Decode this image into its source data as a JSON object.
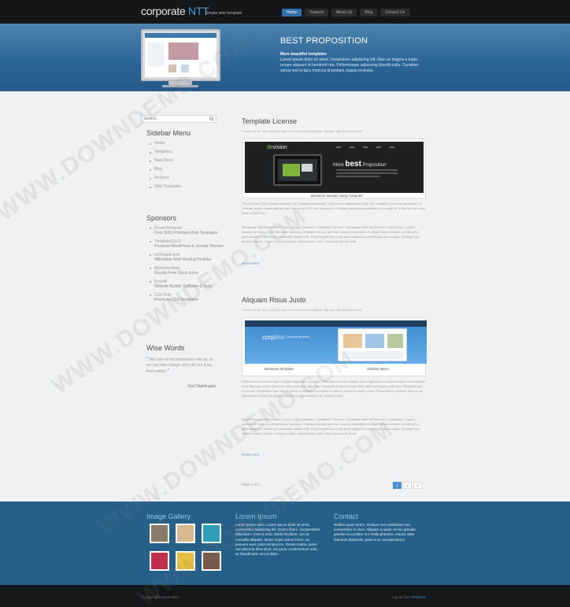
{
  "header": {
    "logo_main": "corporate",
    "logo_accent": "NTT",
    "tagline": "Simple web template",
    "nav": [
      "Home",
      "Support",
      "About Us",
      "Blog",
      "Contact Us"
    ]
  },
  "hero": {
    "title": "BEST PROPOSITION",
    "subtitle": "More beautiful templates",
    "text": "Lorem ipsum dolor sit amet, consectetur adipiscing elit. Nam ac magna a turpis ornare aliquam id hendrerit nisi. Pellentesque adipiscing blandit nulla. Curabitur varius sed et lacu rhoncus id pretium massa molestie."
  },
  "sidebar": {
    "search_value": "Search...",
    "menu_title": "Sidebar Menu",
    "menu": [
      "Home",
      "Templates",
      "Nam Dolor",
      "Blog",
      "Archives",
      "Web Templates"
    ],
    "sponsors_title": "Sponsors",
    "sponsors": [
      {
        "name": "DreamTemplate",
        "desc": "Over 5000 Premium Web Templates"
      },
      {
        "name": "TemplateSOLD",
        "desc": "Premium WordPress & Joomla Themes"
      },
      {
        "name": "ImHosted.com",
        "desc": "Affordable Web Hosting Provider"
      },
      {
        "name": "MyVectorStore",
        "desc": "Royalty Free Stock Icons"
      },
      {
        "name": "Evrsoft",
        "desc": "Website Builder Software & Tools"
      },
      {
        "name": "CSS Hub",
        "desc": "Premium CSS Templates"
      }
    ],
    "quote_title": "Wise Words",
    "quote": "We can let circumstances rule us, or we can take charge and rule our lives from within.",
    "quote_author": "Earl Nightingale"
  },
  "posts": [
    {
      "title": "Template License",
      "meta": "Posted on 08. Sep, 2010 by Saul in Post under templates, internet, with Comments 18",
      "image": {
        "logo": "de",
        "logo_accent": "vision",
        "more": "More",
        "best": "best",
        "proposition": "Proposition",
        "caption": "Business woman using computer"
      },
      "text1": "This is a free CSS website template by CssMoban templates. This work is distributed under the Creative Commons Attribution 3.0 License, which means that you are free to use it for any personal or commercial purpose provided you credit me in the form of a link back to RASCAL.",
      "text2": "Maecenas dignissim mauris in arcu congue tincidunt. Vestibulum elit nunc, accumsan vitae faucibus vel, scelerisque a quam. Aenean at metus id elit bibendum faucibus. Curabitur ultrices ante nec mauris consectetur a aliquet libero lobortis. Ut nibh sem, pellentesque in dictum ac, venenatis blandit erat. Proin feugiat lectus nisi porta sagittis in scelerisque arcu congue. Quisque sed semper mauris. Donec et lacus mauris, vitae pretium risus. Fusce sed dui sit amet.",
      "readmore": "Read more"
    },
    {
      "title": "Aliquam Risus Justo",
      "meta": "Posted on 08. Sep, 2010 by Saul in Post under templates, internet, with Comments 18",
      "image": {
        "logo": "corp",
        "logo_accent": "line",
        "tag": "Corporate template",
        "caption_left": "Business template",
        "caption_right": "Sidebar Menu"
      },
      "text1": "Pellentesque posuere enim et ipsum dignissim convallis. Proin quis molestie mauris. Nunc eget ipsum at nulla tempus euismod quis a mi. Aliquam ornare turpis nec tellus molestie imperdiet. Phasellus sit amet neque vitae ante scelerisque euismod. Phasellus non mi lacinia. Vestibulum ante ipsum primis in faucibus orci luctus et ultrices posuere cubilia Curae; Suspendisse pulvinar, tempus vel ullamcorper. Etiam leo quam, sodales vel pellentesque vel, auctor a ante.",
      "text2": "Maecenas dignissim mauris in arcu congue tincidunt. Vestibulum elit nunc, accumsan vitae faucibus vel, scelerisque a quam. Aenean at metus id elit bibendum faucibus. Curabitur ultrices ante nec mauris consectetur a aliquet libero lobortis. Ut nibh sem, pellentesque in dictum ac, venenatis blandit erat. Proin feugiat lectus nisi porta sagittis in scelerisque arcu congue. Quisque sed semper mauris. Donec et lacus mauris, vitae pretium risus. Fusce sed dui sit amet.",
      "readmore": "Read more"
    }
  ],
  "pagination": {
    "text": "Page 1 of 3",
    "pages": [
      "1",
      "2",
      "3"
    ]
  },
  "footer": {
    "gallery_title": "Image Gallery",
    "gallery_colors": [
      "#8a7a6a",
      "#d8b890",
      "#2f9fb8",
      "#c0304a",
      "#e8c040",
      "#7a5a4a"
    ],
    "lorem_title": "Lorem Ipsum",
    "lorem_text": "Lorem ipsum dolor. Lorem ipsum dolor sit amet, consectetur adipiscing elit. Donec libero. Suspendisse bibendum. Cras id urna. Morbi tincidunt, orci ac convallis aliquam, lectus turpis varius lorem, eu posuere nunc justo tempus leo. Donec mattis, purus nec placerat bibendum, dui pede condimentum odio, ac blandit ante orci ut diam.",
    "contact_title": "Contact",
    "contact_text": "Nullam quam lorem, tristique non vestibulum nec, consectetur in risus. Aliquam a quam vel leo gravida gravida eu porttitor dui. Nulla pharetra, mauris vitae interdum dignissim, justo nunc suscipit ipsum.",
    "copyright": "© Copyright Name 2010",
    "credit_label": "Layout from",
    "credit_link": "RASCAL"
  },
  "watermark": "WWW.DOWNDEMO.COM"
}
